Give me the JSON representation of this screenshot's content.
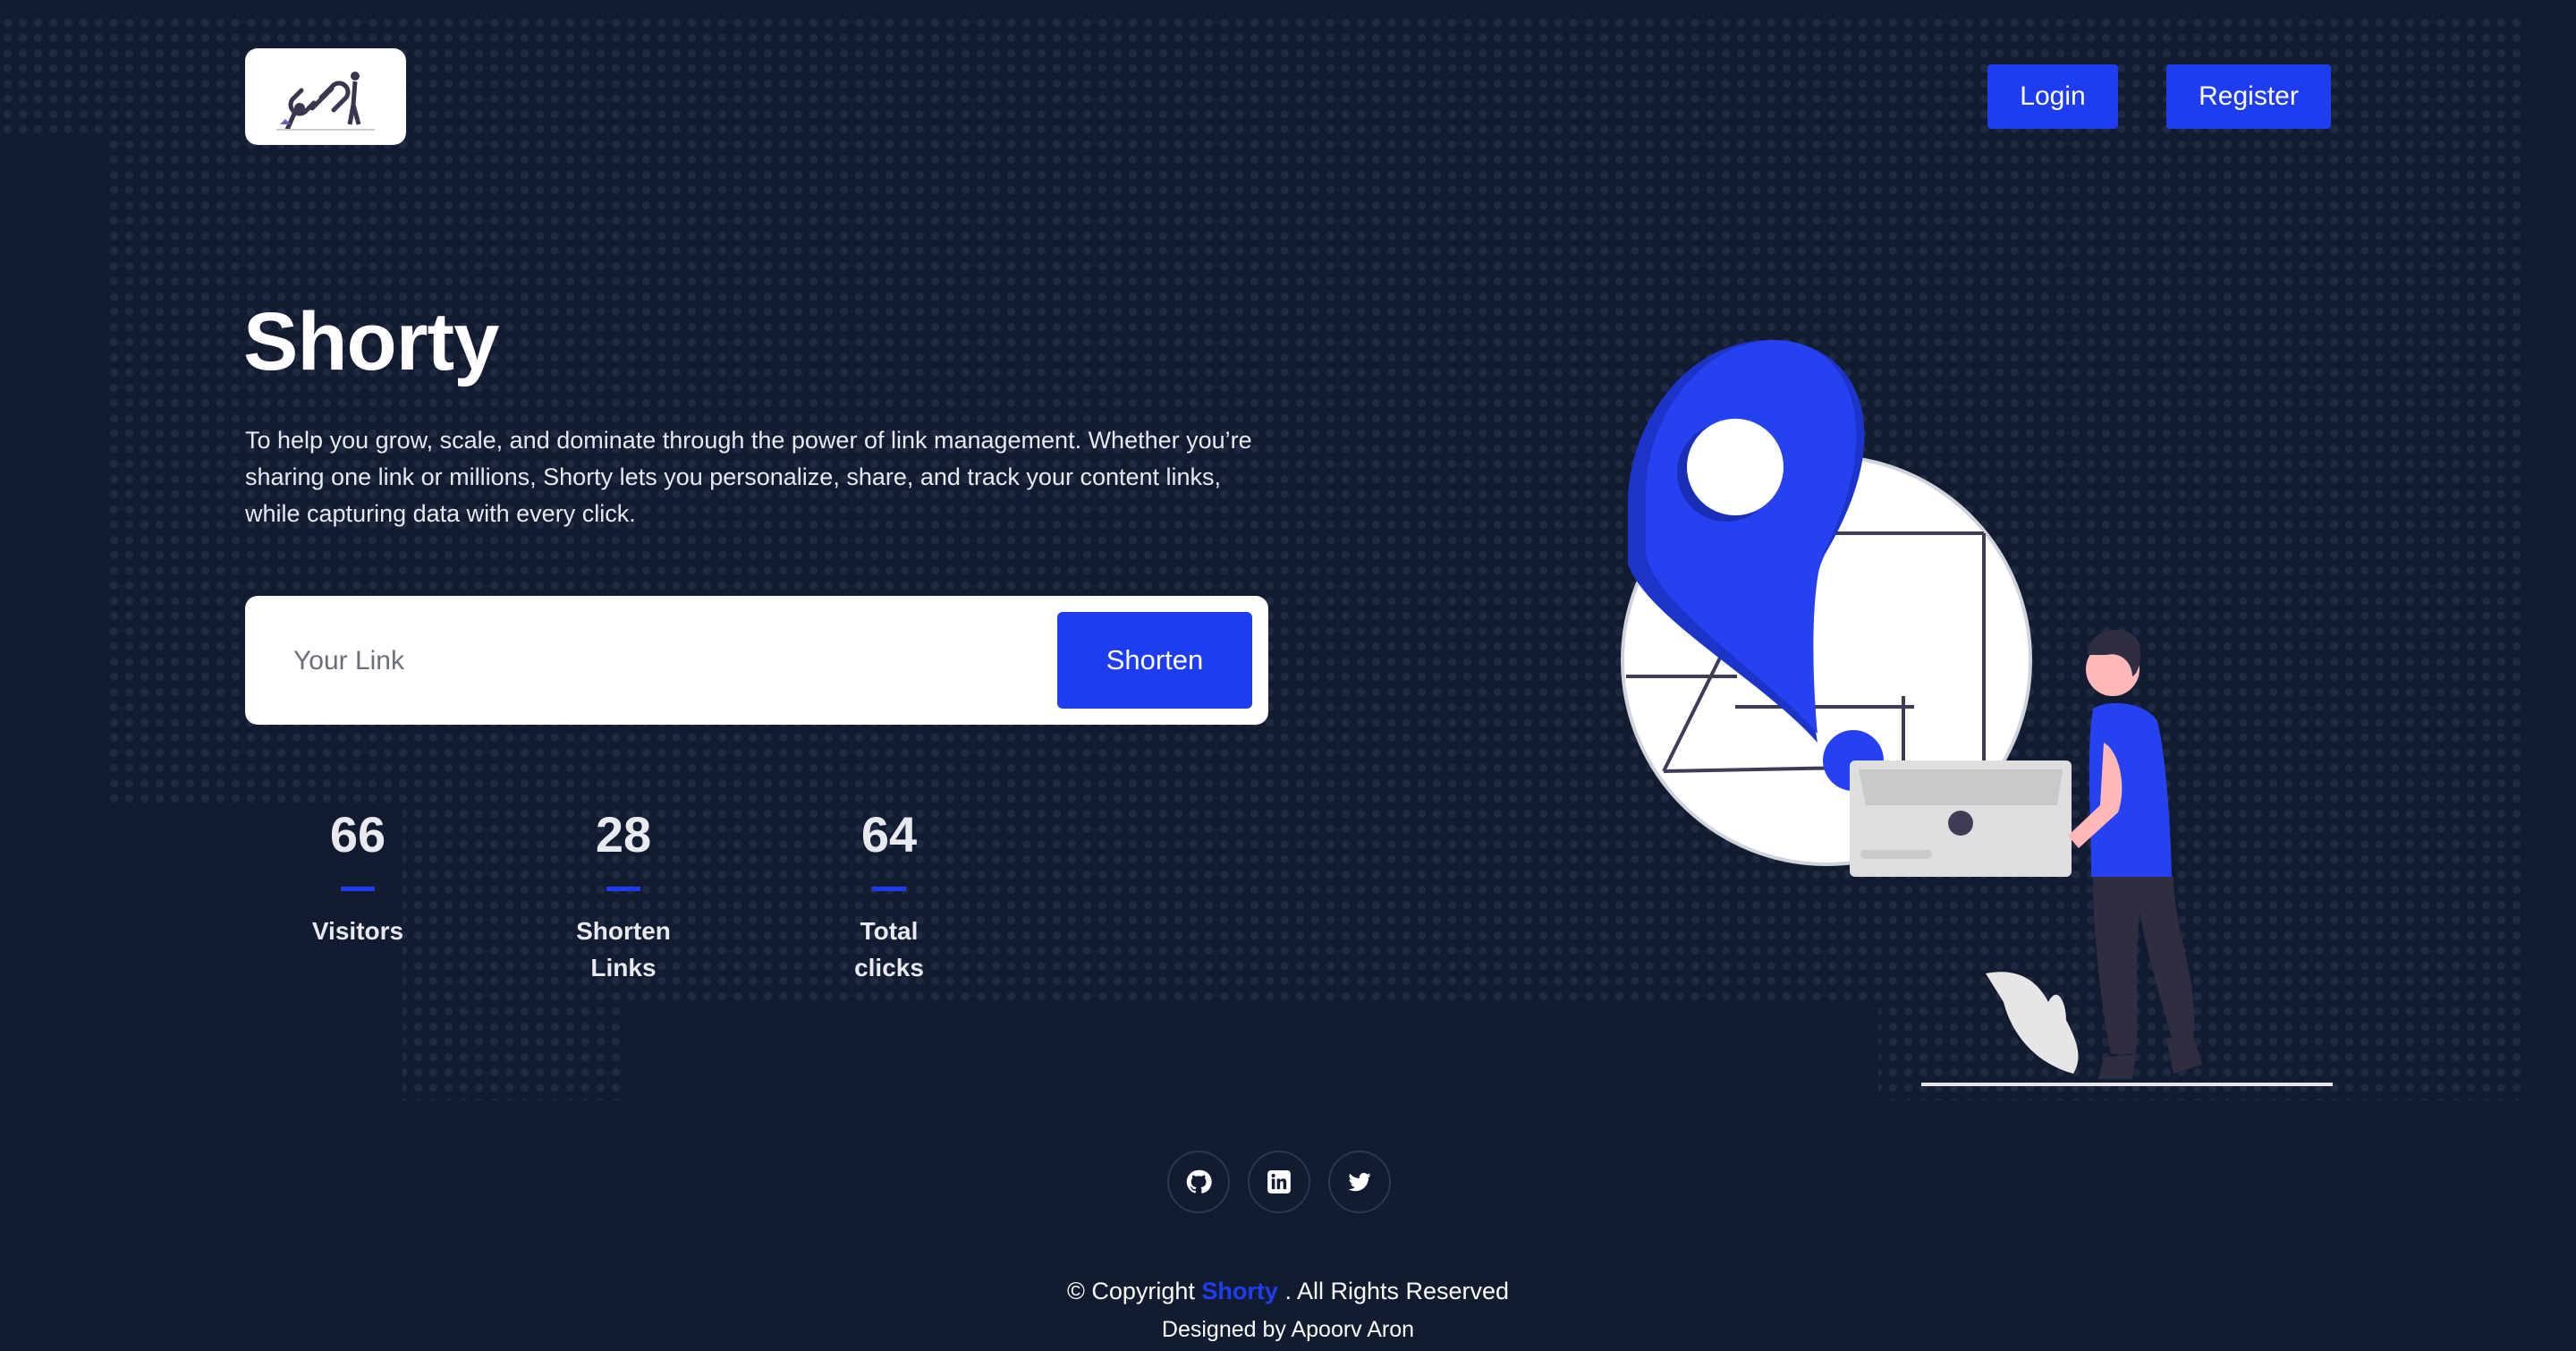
{
  "header": {
    "login_label": "Login",
    "register_label": "Register"
  },
  "hero": {
    "title": "Shorty",
    "description": "To help you grow, scale, and dominate through the power of link management. Whether you’re sharing one link or millions, Shorty lets you personalize, share, and track your content links, while capturing data with every click."
  },
  "shortener": {
    "placeholder": "Your Link",
    "button_label": "Shorten"
  },
  "stats": [
    {
      "value": "66",
      "label": "Visitors"
    },
    {
      "value": "28",
      "label": "Shorten Links"
    },
    {
      "value": "64",
      "label": "Total clicks"
    }
  ],
  "social": [
    {
      "icon": "github-icon"
    },
    {
      "icon": "linkedin-icon"
    },
    {
      "icon": "twitter-icon"
    }
  ],
  "footer": {
    "copyright_prefix": "© Copyright",
    "brand": "Shorty",
    "copyright_suffix": ". All Rights Reserved",
    "designed_by": "Designed by Apoorv Aron"
  },
  "colors": {
    "background": "#121b30",
    "accent": "#1f3df0",
    "map_dots": "#2a3550"
  }
}
